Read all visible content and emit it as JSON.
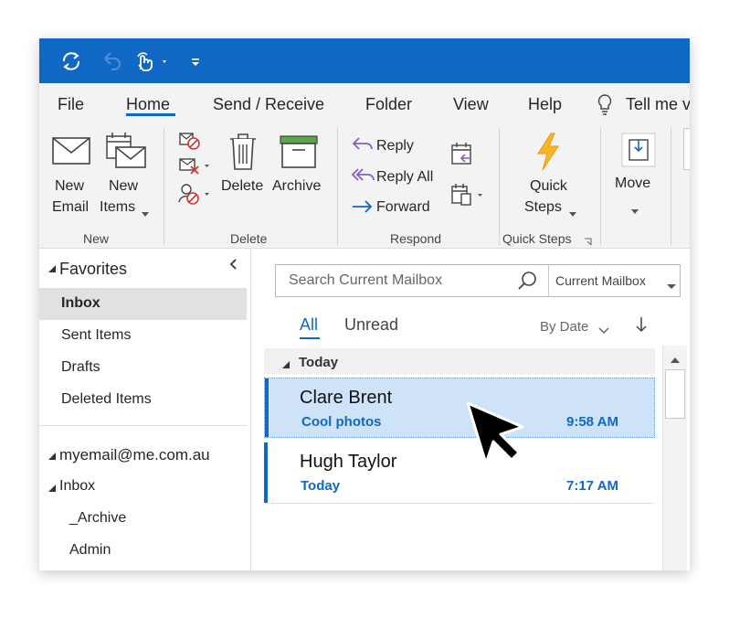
{
  "quick_access": {
    "sync_icon": "sync-icon",
    "undo_icon": "undo-icon",
    "touch_icon": "touch-mode-icon",
    "customize_icon": "customize-toolbar-icon"
  },
  "tabs": [
    {
      "label": "File"
    },
    {
      "label": "Home",
      "active": true
    },
    {
      "label": "Send / Receive"
    },
    {
      "label": "Folder"
    },
    {
      "label": "View"
    },
    {
      "label": "Help"
    },
    {
      "label": "Tell me v"
    }
  ],
  "ribbon": {
    "new": {
      "new_email_line1": "New",
      "new_email_line2": "Email",
      "new_items_line1": "New",
      "new_items_line2": "Items",
      "group_label": "New"
    },
    "delete": {
      "delete_label": "Delete",
      "archive_label": "Archive",
      "group_label": "Delete"
    },
    "respond": {
      "reply_label": "Reply",
      "reply_all_label": "Reply All",
      "forward_label": "Forward",
      "group_label": "Respond"
    },
    "quick_steps": {
      "line1": "Quick",
      "line2": "Steps",
      "group_label": "Quick Steps"
    },
    "move": {
      "label": "Move"
    }
  },
  "sidebar": {
    "favorites_label": "Favorites",
    "favorites": [
      {
        "label": "Inbox",
        "selected": true
      },
      {
        "label": "Sent Items"
      },
      {
        "label": "Drafts"
      },
      {
        "label": "Deleted Items"
      }
    ],
    "account_label": "myemail@me.com.au",
    "inbox_label": "Inbox",
    "folders": [
      {
        "label": "_Archive"
      },
      {
        "label": "Admin"
      }
    ]
  },
  "mail_list": {
    "search_placeholder": "Search Current Mailbox",
    "scope": "Current Mailbox",
    "filter_all": "All",
    "filter_unread": "Unread",
    "sort_label": "By Date",
    "group_today": "Today",
    "messages": [
      {
        "sender": "Clare Brent",
        "subject": "Cool photos",
        "time": "9:58 AM",
        "selected": true
      },
      {
        "sender": "Hugh Taylor",
        "subject": "Today",
        "time": "7:17 AM",
        "selected": false
      }
    ]
  },
  "colors": {
    "title_bar": "#1068c4",
    "accent": "#1068c4",
    "selected_message_bg": "#cfe3f8",
    "ribbon_bg": "#f3f3f3"
  }
}
